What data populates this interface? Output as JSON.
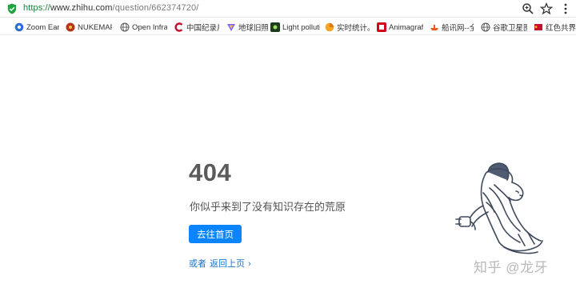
{
  "address_bar": {
    "url_scheme": "https://",
    "url_host": "www.zhihu.com",
    "url_path": "/question/662374720/",
    "icons": [
      "shield-icon",
      "zoom-icon",
      "star-icon",
      "more-icon"
    ]
  },
  "bookmarks": [
    {
      "label": "Zoom Earth",
      "icon": "globe-icon",
      "color": "#2b6cd6"
    },
    {
      "label": "NUKEMAP",
      "icon": "nukemap-icon",
      "color": "#b5331f"
    },
    {
      "label": "Open Infra",
      "icon": "globe-icon",
      "color": "#555555"
    },
    {
      "label": "中国纪录片",
      "icon": "cntv-icon",
      "color": "#c8102e"
    },
    {
      "label": "地球旧照",
      "icon": "triangle-icon",
      "color": "#7b61ff"
    },
    {
      "label": "Light pollution",
      "icon": "lightpollution-icon",
      "color": "#1d3b1d"
    },
    {
      "label": "实时统计。",
      "icon": "stats-icon",
      "color": "#f5a623"
    },
    {
      "label": "Animagraffs",
      "icon": "animagraffs-icon",
      "color": "#d0021b"
    },
    {
      "label": "船讯网--全",
      "icon": "ship-icon",
      "color": "#e85d1c"
    },
    {
      "label": "谷歌卫星图",
      "icon": "globe-icon",
      "color": "#555555"
    },
    {
      "label": "红色共界-",
      "icon": "flag-icon",
      "color": "#c8102e"
    }
  ],
  "error": {
    "code": "404",
    "message": "你似乎来到了没有知识存在的荒原",
    "home_button": "去往首页",
    "or_label": "或者",
    "back_label": "返回上页",
    "chevron": "›"
  },
  "watermark": "知乎 @龙牙",
  "colors": {
    "primary": "#0b84ff",
    "link": "#1e73c8",
    "code": "#5a5a5a",
    "secure": "#1a7f37"
  }
}
